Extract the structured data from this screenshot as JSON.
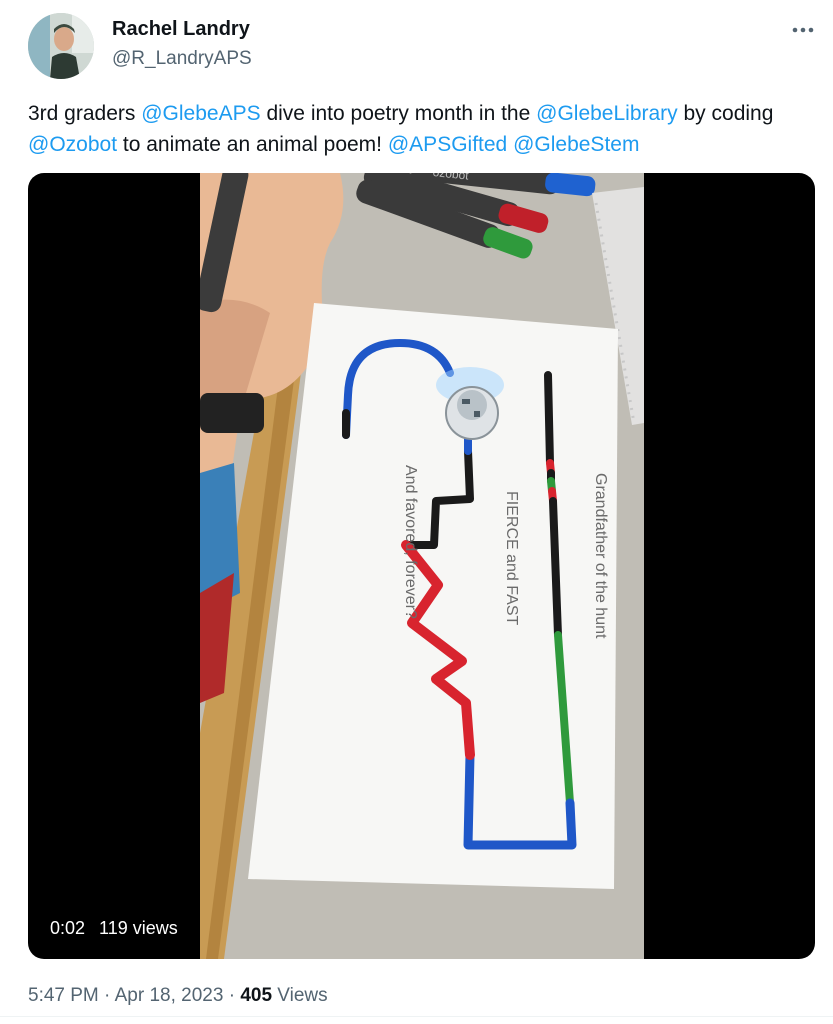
{
  "author": {
    "name": "Rachel Landry",
    "handle": "@R_LandryAPS"
  },
  "tweet": {
    "segments": [
      {
        "text": "3rd graders ",
        "type": "text"
      },
      {
        "text": "@GlebeAPS",
        "type": "mention"
      },
      {
        "text": " dive into poetry month in the ",
        "type": "text"
      },
      {
        "text": "@GlebeLibrary",
        "type": "mention"
      },
      {
        "text": " by coding ",
        "type": "text"
      },
      {
        "text": "@Ozobot",
        "type": "mention"
      },
      {
        "text": " to animate an animal poem! ",
        "type": "text"
      },
      {
        "text": "@APSGifted",
        "type": "mention"
      },
      {
        "text": " ",
        "type": "text"
      },
      {
        "text": "@GlebeStem",
        "type": "mention"
      }
    ]
  },
  "video": {
    "time": "0:02",
    "views": "119 views",
    "poem_lines": [
      "Grandfather of the hunt",
      "FIERCE and FAST",
      "And favored, forever?"
    ],
    "marker_brand": "ozobot"
  },
  "footer": {
    "time": "5:47 PM",
    "separator": " · ",
    "date": "Apr 18, 2023",
    "views_count": "405",
    "views_label": "Views"
  },
  "colors": {
    "mention": "#1d9bf0",
    "track_black": "#1a1a1a",
    "track_blue": "#1f57c8",
    "track_red": "#d8242e",
    "track_green": "#2f9a3c"
  },
  "icons": [
    "more-icon"
  ]
}
